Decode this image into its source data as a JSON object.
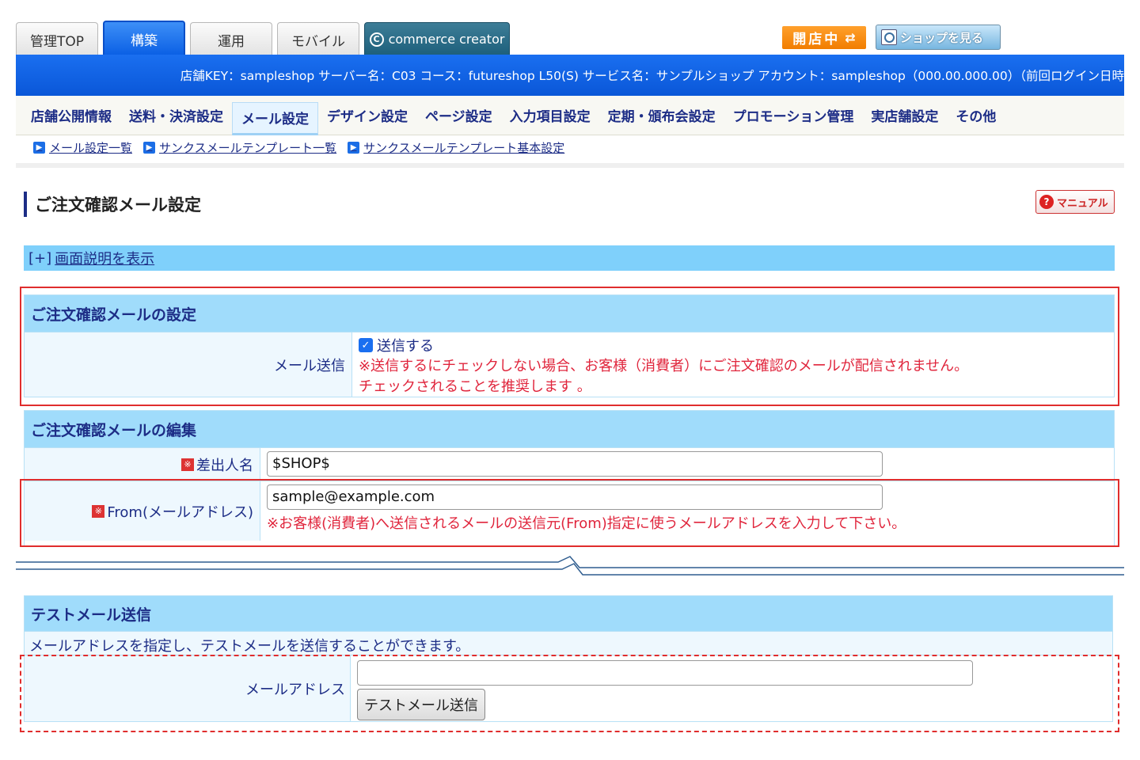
{
  "top_tabs": [
    {
      "label": "管理TOP",
      "active": false
    },
    {
      "label": "構築",
      "active": true
    },
    {
      "label": "運用",
      "active": false
    },
    {
      "label": "モバイル",
      "active": false
    }
  ],
  "commerce_creator": {
    "label": "commerce creator",
    "logo": "C"
  },
  "status": {
    "open_label": "開店中",
    "swap_icon": "⇄",
    "view_shop_label": "ショップを見る"
  },
  "info_bar": "店舗KEY：sampleshop サーバー名：C03 コース：futureshop L50(S) サービス名：サンプルショップ アカウント：sampleshop（000.00.000.00）（前回ログイン日時",
  "main_nav": [
    "店舗公開情報",
    "送料・決済設定",
    "メール設定",
    "デザイン設定",
    "ページ設定",
    "入力項目設定",
    "定期・頒布会設定",
    "プロモーション管理",
    "実店舗設定",
    "その他"
  ],
  "sub_nav": [
    "メール設定一覧",
    "サンクスメールテンプレート一覧",
    "サンクスメールテンプレート基本設定"
  ],
  "page_title": "ご注文確認メール設定",
  "manual_label": "マニュアル",
  "desc_bar": {
    "plus": "[+]",
    "link": "画面説明を表示"
  },
  "section1": {
    "title": "ご注文確認メールの設定",
    "row_label": "メール送信",
    "checkbox_label": "送信する",
    "checked": true,
    "note1": "※送信するにチェックしない場合、お客様（消費者）にご注文確認のメールが配信されません。",
    "note2": "チェックされることを推奨します 。"
  },
  "section2": {
    "title": "ご注文確認メールの編集",
    "sender_label": "差出人名",
    "sender_value": "$SHOP$",
    "from_label": "From(メールアドレス)",
    "from_value": "sample@example.com",
    "from_note": "※お客様(消費者)へ送信されるメールの送信元(From)指定に使うメールアドレスを入力して下さい。",
    "required_mark": "※"
  },
  "test_section": {
    "title": "テストメール送信",
    "description": "メールアドレスを指定し、テストメールを送信することができます。",
    "address_label": "メールアドレス",
    "address_value": "",
    "send_button": "テストメール送信"
  }
}
